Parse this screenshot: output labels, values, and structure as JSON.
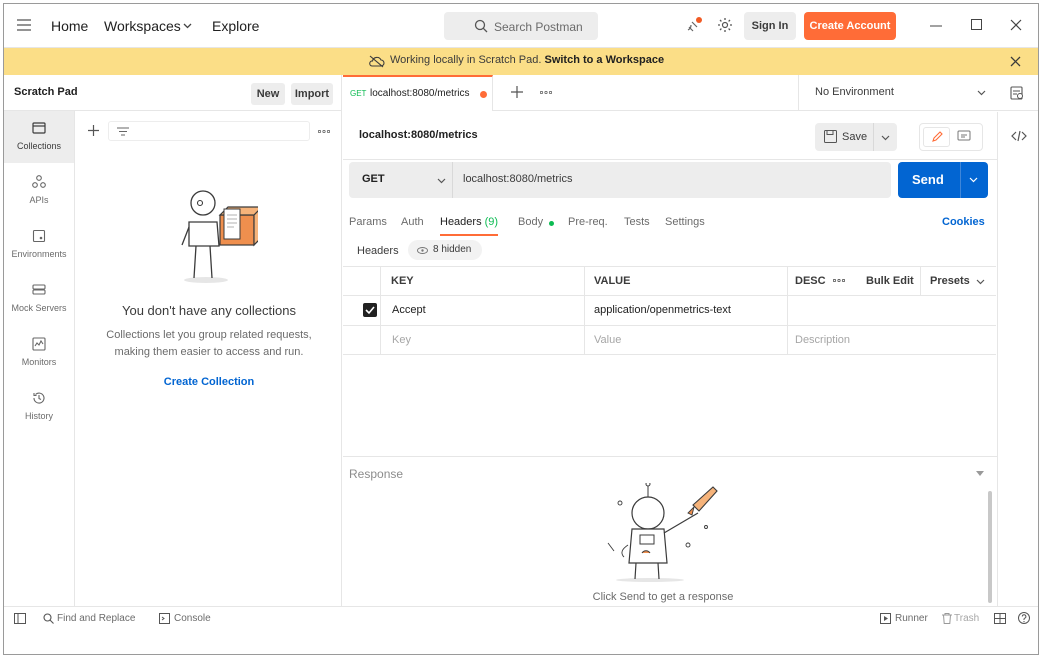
{
  "topbar": {
    "nav": [
      "Home",
      "Workspaces",
      "Explore"
    ],
    "search_placeholder": "Search Postman",
    "signin": "Sign In",
    "create_account": "Create Account"
  },
  "banner": {
    "text": "Working locally in Scratch Pad.",
    "link": "Switch to a Workspace"
  },
  "sidebar": {
    "title": "Scratch Pad",
    "new_label": "New",
    "import_label": "Import",
    "rail": [
      {
        "label": "Collections",
        "icon": "collections-icon"
      },
      {
        "label": "APIs",
        "icon": "apis-icon"
      },
      {
        "label": "Environments",
        "icon": "environments-icon"
      },
      {
        "label": "Mock Servers",
        "icon": "mock-servers-icon"
      },
      {
        "label": "Monitors",
        "icon": "monitors-icon"
      },
      {
        "label": "History",
        "icon": "history-icon"
      }
    ],
    "empty_title": "You don't have any collections",
    "empty_desc": "Collections let you group related requests, making them easier to access and run.",
    "empty_link": "Create Collection"
  },
  "tabs": {
    "active_method": "GET",
    "active_url": "localhost:8080/metrics",
    "environment": "No Environment"
  },
  "request": {
    "title": "localhost:8080/metrics",
    "save_label": "Save",
    "method": "GET",
    "url": "localhost:8080/metrics",
    "send_label": "Send",
    "subtabs": [
      "Params",
      "Auth",
      "Headers",
      "Body",
      "Pre-req.",
      "Tests",
      "Settings"
    ],
    "headers_count": "(9)",
    "cookies_label": "Cookies",
    "headers_label": "Headers",
    "hidden_label": "8 hidden"
  },
  "headers_table": {
    "columns": [
      "KEY",
      "VALUE",
      "DESC"
    ],
    "bulk_edit": "Bulk Edit",
    "presets": "Presets",
    "rows": [
      {
        "key": "Accept",
        "value": "application/openmetrics-text",
        "checked": true
      }
    ],
    "placeholder": {
      "key": "Key",
      "value": "Value",
      "description": "Description"
    }
  },
  "response": {
    "label": "Response",
    "hint": "Click Send to get a response"
  },
  "statusbar": {
    "find_replace": "Find and Replace",
    "console": "Console",
    "runner": "Runner",
    "trash": "Trash"
  },
  "colors": {
    "accent": "#ff6c37",
    "send": "#0265d2",
    "banner": "#fbde87"
  }
}
